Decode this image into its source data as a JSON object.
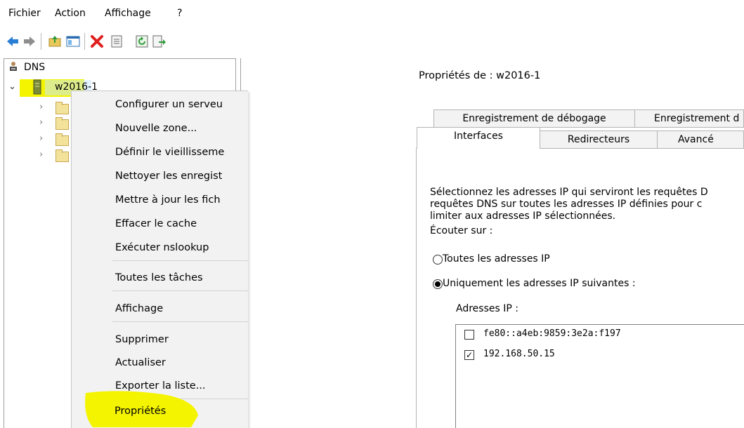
{
  "menubar": {
    "items": [
      "Fichier",
      "Action",
      "Affichage",
      "?"
    ]
  },
  "toolbar": {
    "icons": [
      "back-arrow-icon",
      "forward-arrow-icon",
      "up-folder-icon",
      "show-hide-tree-icon",
      "delete-icon",
      "properties-icon",
      "refresh-icon",
      "export-list-icon"
    ]
  },
  "tree": {
    "root": "DNS",
    "server": "w2016-1"
  },
  "context_menu": {
    "items": [
      "Configurer un serveu",
      "Nouvelle zone...",
      "Définir le vieillisseme",
      "Nettoyer les enregist",
      "Mettre à jour les fich",
      "Effacer le cache",
      "Exécuter nslookup",
      "Toutes les tâches",
      "Affichage",
      "Supprimer",
      "Actualiser",
      "Exporter la liste...",
      "Propriétés"
    ]
  },
  "dialog": {
    "title": "Propriétés de : w2016-1",
    "tabs_row1": [
      "Enregistrement de débogage",
      "Enregistrement d"
    ],
    "tabs_row2": [
      "Interfaces",
      "Redirecteurs",
      "Avancé"
    ],
    "description": [
      "Sélectionnez les adresses IP qui serviront les requêtes D",
      "requêtes DNS sur toutes les adresses IP définies pour c",
      "limiter aux adresses IP sélectionnées."
    ],
    "listen_label": "Écouter sur :",
    "radio_all": "Toutes les adresses IP",
    "radio_only": "Uniquement les adresses IP suivantes :",
    "ip_label": "Adresses IP :",
    "ip_list": [
      {
        "address": "fe80::a4eb:9859:3e2a:f197",
        "checked": false
      },
      {
        "address": "192.168.50.15",
        "checked": true
      }
    ]
  },
  "colors": {
    "highlight": "#f4f400",
    "selection": "#cce8ff"
  }
}
